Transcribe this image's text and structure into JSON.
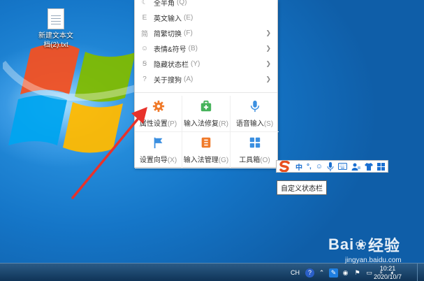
{
  "desktop": {
    "file_icon_label": "新建文本文档(2).txt"
  },
  "menu": {
    "items": [
      {
        "label": "全半角",
        "key": "(Q)",
        "icon": "moon-icon",
        "has_submenu": false
      },
      {
        "label": "英文输入",
        "key": "(E)",
        "icon": "english-icon",
        "has_submenu": false
      },
      {
        "label": "简繁切换",
        "key": "(F)",
        "icon": "jian-icon",
        "has_submenu": true,
        "icon_text": "简"
      },
      {
        "label": "表情&符号",
        "key": "(B)",
        "icon": "smiley-icon",
        "has_submenu": true
      },
      {
        "label": "隐藏状态栏",
        "key": "(Y)",
        "icon": "sogou-s-icon",
        "has_submenu": true
      },
      {
        "label": "关于搜狗",
        "key": "(A)",
        "icon": "help-icon",
        "has_submenu": true
      }
    ],
    "grid": [
      {
        "label": "属性设置",
        "key": "(P)",
        "icon": "gear-icon",
        "color": "#f07a2a"
      },
      {
        "label": "输入法修复",
        "key": "(R)",
        "icon": "repair-kit-icon",
        "color": "#46b35a"
      },
      {
        "label": "语音输入",
        "key": "(S)",
        "icon": "microphone-icon",
        "color": "#3b8fe0"
      },
      {
        "label": "设置向导",
        "key": "(X)",
        "icon": "flag-icon",
        "color": "#3b8fe0"
      },
      {
        "label": "输入法管理",
        "key": "(G)",
        "icon": "manager-icon",
        "color": "#f07a2a"
      },
      {
        "label": "工具箱",
        "key": "(O)",
        "icon": "toolbox-icon",
        "color": "#3b8fe0"
      }
    ]
  },
  "imebar": {
    "logo": "S",
    "mode": "中",
    "punct": "°,"
  },
  "tooltip": "自定义状态栏",
  "taskbar": {
    "lang": "CH",
    "time": "10:21",
    "date": "2020/10/7"
  },
  "watermark": {
    "main": "Bai",
    "main2": "经验",
    "url": "jingyan.baidu.com"
  },
  "colors": {
    "accent_orange": "#f07a2a",
    "accent_blue": "#3b8fe0",
    "annotation_red": "#e8322b"
  }
}
